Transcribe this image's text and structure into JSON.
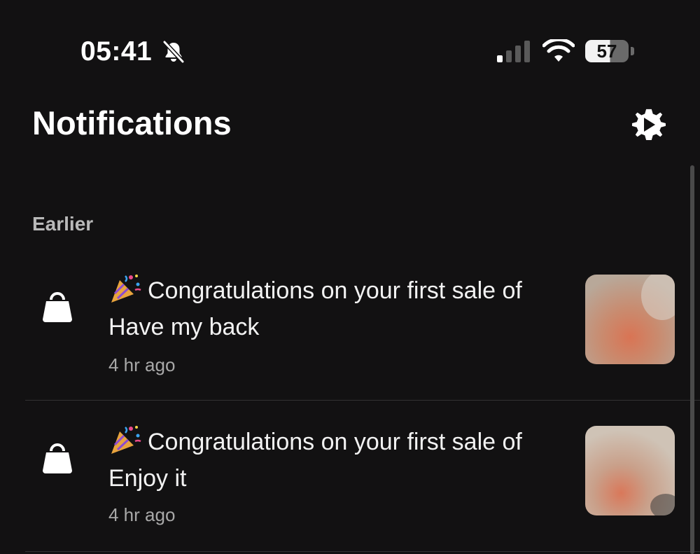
{
  "status_bar": {
    "time": "05:41",
    "battery": "57",
    "signal_icon": "cellular-signal-icon",
    "wifi_icon": "wifi-icon",
    "mute_icon": "bell-slash-icon"
  },
  "header": {
    "title": "Notifications",
    "settings_icon": "gear-icon"
  },
  "section": {
    "label": "Earlier"
  },
  "notifications": [
    {
      "icon": "shopping-bag-icon",
      "emoji": "party-popper-icon",
      "message": "Congratulations on your first sale of Have my back",
      "time": "4 hr ago",
      "thumbnail": "blurred-product-image"
    },
    {
      "icon": "shopping-bag-icon",
      "emoji": "party-popper-icon",
      "message": "Congratulations on your first sale of Enjoy it",
      "time": "4 hr ago",
      "thumbnail": "blurred-product-image"
    }
  ],
  "colors": {
    "background": "#121112",
    "text_primary": "#ffffff",
    "text_secondary": "#a8a8a8",
    "section_label": "#b9b9b9",
    "divider": "#323232"
  }
}
